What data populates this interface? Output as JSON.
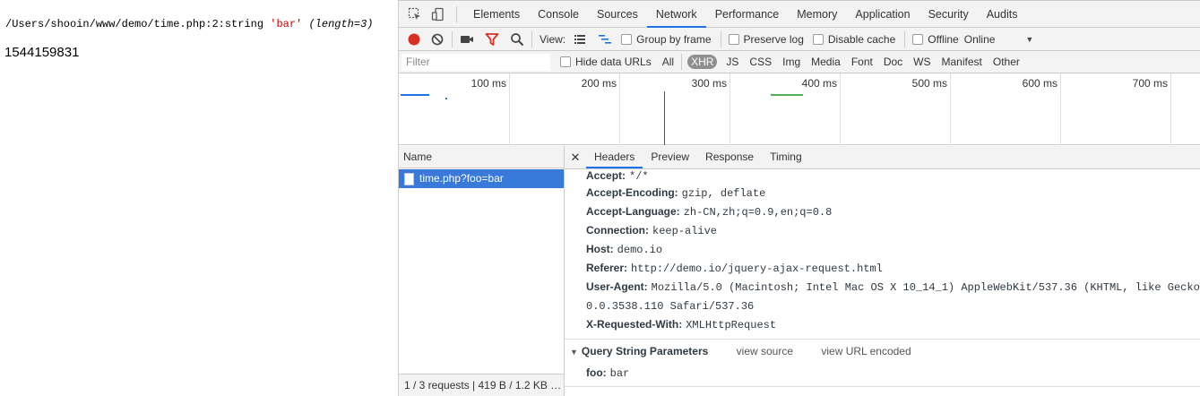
{
  "page": {
    "dump_path": "/Users/shooin/www/demo/time.php:2:string",
    "dump_value": "'bar'",
    "dump_length": "(length=3)",
    "timestamp": "1544159831"
  },
  "devtools": {
    "tabs": [
      "Elements",
      "Console",
      "Sources",
      "Network",
      "Performance",
      "Memory",
      "Application",
      "Security",
      "Audits"
    ],
    "active_tab": "Network",
    "toolbar": {
      "view_label": "View:",
      "group_by_frame": "Group by frame",
      "preserve_log": "Preserve log",
      "disable_cache": "Disable cache",
      "offline": "Offline",
      "throttle": "Online"
    },
    "filter": {
      "placeholder": "Filter",
      "hide_data_urls": "Hide data URLs",
      "types": [
        "All",
        "XHR",
        "JS",
        "CSS",
        "Img",
        "Media",
        "Font",
        "Doc",
        "WS",
        "Manifest",
        "Other"
      ],
      "active_type": "XHR"
    },
    "timeline": {
      "ticks": [
        "100 ms",
        "200 ms",
        "300 ms",
        "400 ms",
        "500 ms",
        "600 ms",
        "700 ms"
      ]
    },
    "requests": {
      "column": "Name",
      "items": [
        {
          "name": "time.php?foo=bar"
        }
      ],
      "status": "1 / 3 requests | 419 B / 1.2 KB …"
    },
    "details": {
      "tabs": [
        "Headers",
        "Preview",
        "Response",
        "Timing"
      ],
      "active_tab": "Headers",
      "headers": [
        {
          "name": "Accept:",
          "value": "*/*"
        },
        {
          "name": "Accept-Encoding:",
          "value": "gzip, deflate"
        },
        {
          "name": "Accept-Language:",
          "value": "zh-CN,zh;q=0.9,en;q=0.8"
        },
        {
          "name": "Connection:",
          "value": "keep-alive"
        },
        {
          "name": "Host:",
          "value": "demo.io"
        },
        {
          "name": "Referer:",
          "value": "http://demo.io/jquery-ajax-request.html"
        },
        {
          "name": "User-Agent:",
          "value": "Mozilla/5.0 (Macintosh; Intel Mac OS X 10_14_1) AppleWebKit/537.36 (KHTML, like Gecko",
          "continuation": "0.0.3538.110 Safari/537.36"
        },
        {
          "name": "X-Requested-With:",
          "value": "XMLHttpRequest"
        }
      ],
      "query_section": {
        "title": "Query String Parameters",
        "view_source": "view source",
        "view_url_encoded": "view URL encoded",
        "params": [
          {
            "name": "foo:",
            "value": "bar"
          }
        ]
      }
    }
  },
  "colors": {
    "accent": "#1a73e8",
    "selected_row": "#3879d9",
    "record": "#d93025",
    "filter_red": "#d93025"
  }
}
